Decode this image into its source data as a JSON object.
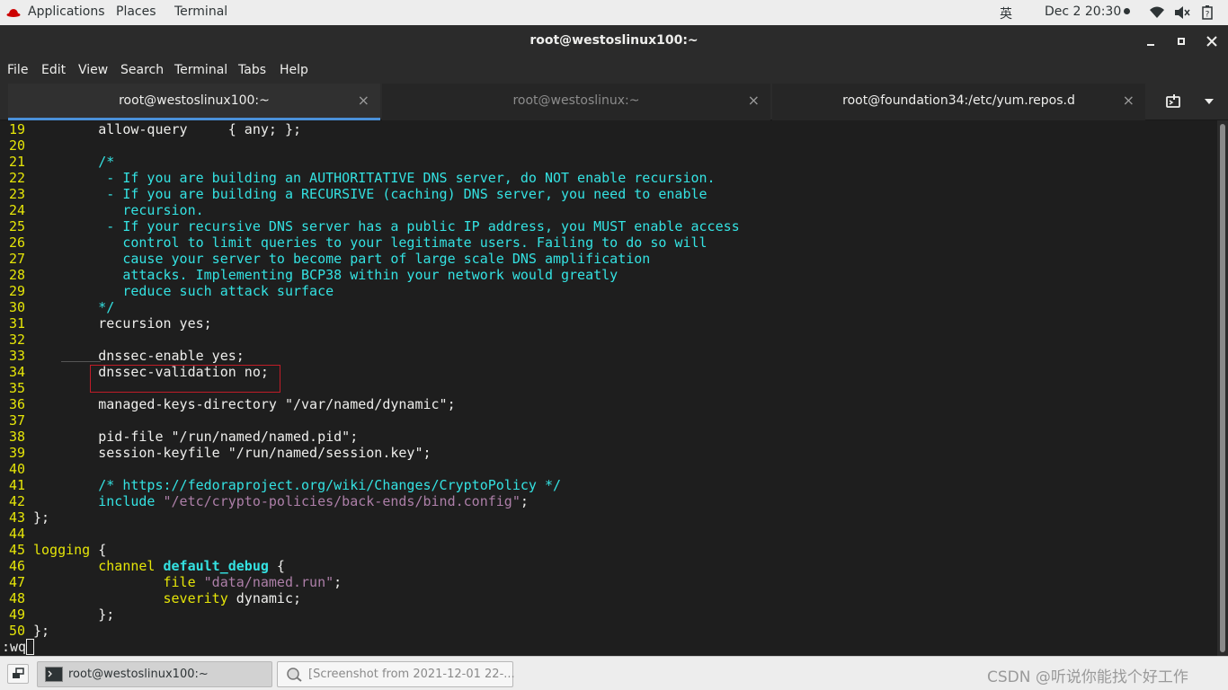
{
  "top_panel": {
    "applications": "Applications",
    "places": "Places",
    "terminal": "Terminal",
    "input_method": "英",
    "clock": "Dec 2  20:30"
  },
  "window": {
    "title": "root@westoslinux100:~",
    "minimize": "–",
    "maximize": "■",
    "close": "✕"
  },
  "menubar": {
    "file": "File",
    "edit": "Edit",
    "view": "View",
    "search": "Search",
    "terminal": "Terminal",
    "tabs": "Tabs",
    "help": "Help"
  },
  "tabs": [
    {
      "label": "root@westoslinux100:~",
      "close": "×",
      "active": true
    },
    {
      "label": "root@westoslinux:~",
      "close": "×",
      "active": false
    },
    {
      "label": "root@foundation34:/etc/yum.repos.d",
      "close": "×",
      "active": false
    }
  ],
  "terminal": {
    "lines": [
      {
        "n": "19",
        "parts": [
          {
            "t": "        allow-query     { any; };",
            "c": ""
          }
        ]
      },
      {
        "n": "20",
        "parts": []
      },
      {
        "n": "21",
        "parts": [
          {
            "t": "        /*",
            "c": "cm"
          }
        ]
      },
      {
        "n": "22",
        "parts": [
          {
            "t": "         - If you are building an AUTHORITATIVE DNS server, do NOT enable recursion.",
            "c": "cm"
          }
        ]
      },
      {
        "n": "23",
        "parts": [
          {
            "t": "         - If you are building a RECURSIVE (caching) DNS server, you need to enable",
            "c": "cm"
          }
        ]
      },
      {
        "n": "24",
        "parts": [
          {
            "t": "           recursion.",
            "c": "cm"
          }
        ]
      },
      {
        "n": "25",
        "parts": [
          {
            "t": "         - If your recursive DNS server has a public IP address, you MUST enable access",
            "c": "cm"
          }
        ]
      },
      {
        "n": "26",
        "parts": [
          {
            "t": "           control to limit queries to your legitimate users. Failing to do so will",
            "c": "cm"
          }
        ]
      },
      {
        "n": "27",
        "parts": [
          {
            "t": "           cause your server to become part of large scale DNS amplification",
            "c": "cm"
          }
        ]
      },
      {
        "n": "28",
        "parts": [
          {
            "t": "           attacks. Implementing BCP38 within your network would greatly",
            "c": "cm"
          }
        ]
      },
      {
        "n": "29",
        "parts": [
          {
            "t": "           reduce such attack surface",
            "c": "cm"
          }
        ]
      },
      {
        "n": "30",
        "parts": [
          {
            "t": "        */",
            "c": "cm"
          }
        ]
      },
      {
        "n": "31",
        "parts": [
          {
            "t": "        recursion yes;",
            "c": ""
          }
        ]
      },
      {
        "n": "32",
        "parts": []
      },
      {
        "n": "33",
        "parts": [
          {
            "t": "        dnssec-enable yes;",
            "c": ""
          }
        ]
      },
      {
        "n": "34",
        "parts": [
          {
            "t": "        dnssec-validation no;",
            "c": ""
          }
        ]
      },
      {
        "n": "35",
        "parts": []
      },
      {
        "n": "36",
        "parts": [
          {
            "t": "        managed-keys-directory \"/var/named/dynamic\";",
            "c": ""
          }
        ]
      },
      {
        "n": "37",
        "parts": []
      },
      {
        "n": "38",
        "parts": [
          {
            "t": "        pid-file \"/run/named/named.pid\";",
            "c": ""
          }
        ]
      },
      {
        "n": "39",
        "parts": [
          {
            "t": "        session-keyfile \"/run/named/session.key\";",
            "c": ""
          }
        ]
      },
      {
        "n": "40",
        "parts": []
      },
      {
        "n": "41",
        "parts": [
          {
            "t": "        /* https://fedoraproject.org/wiki/Changes/CryptoPolicy */",
            "c": "cm"
          }
        ]
      },
      {
        "n": "42",
        "parts": [
          {
            "t": "        ",
            "c": ""
          },
          {
            "t": "include",
            "c": "kw"
          },
          {
            "t": " ",
            "c": ""
          },
          {
            "t": "\"/etc/crypto-policies/back-ends/bind.config\"",
            "c": "str"
          },
          {
            "t": ";",
            "c": ""
          }
        ]
      },
      {
        "n": "43",
        "parts": [
          {
            "t": "};",
            "c": ""
          }
        ]
      },
      {
        "n": "44",
        "parts": []
      },
      {
        "n": "45",
        "parts": [
          {
            "t": "logging",
            "c": "yl"
          },
          {
            "t": " {",
            "c": ""
          }
        ]
      },
      {
        "n": "46",
        "parts": [
          {
            "t": "        ",
            "c": ""
          },
          {
            "t": "channel",
            "c": "yl"
          },
          {
            "t": " ",
            "c": ""
          },
          {
            "t": "default_debug",
            "c": "kwb"
          },
          {
            "t": " {",
            "c": ""
          }
        ]
      },
      {
        "n": "47",
        "parts": [
          {
            "t": "                ",
            "c": ""
          },
          {
            "t": "file",
            "c": "yl"
          },
          {
            "t": " ",
            "c": ""
          },
          {
            "t": "\"data/named.run\"",
            "c": "str"
          },
          {
            "t": ";",
            "c": ""
          }
        ]
      },
      {
        "n": "48",
        "parts": [
          {
            "t": "                ",
            "c": ""
          },
          {
            "t": "severity",
            "c": "yl"
          },
          {
            "t": " dynamic;",
            "c": ""
          }
        ]
      },
      {
        "n": "49",
        "parts": [
          {
            "t": "        };",
            "c": ""
          }
        ]
      },
      {
        "n": "50",
        "parts": [
          {
            "t": "};",
            "c": ""
          }
        ]
      }
    ],
    "command_line": ":wq"
  },
  "taskbar": {
    "task1": "root@westoslinux100:~",
    "task2": "[Screenshot from 2021-12-01 22-...",
    "watermark": "CSDN @听说你能找个好工作"
  },
  "colors": {
    "accent": "#4a90d9",
    "highlight_box": "#c01c28",
    "line_numbers": "#e5e508",
    "comments": "#34e2e2",
    "strings": "#ad7fa8"
  }
}
